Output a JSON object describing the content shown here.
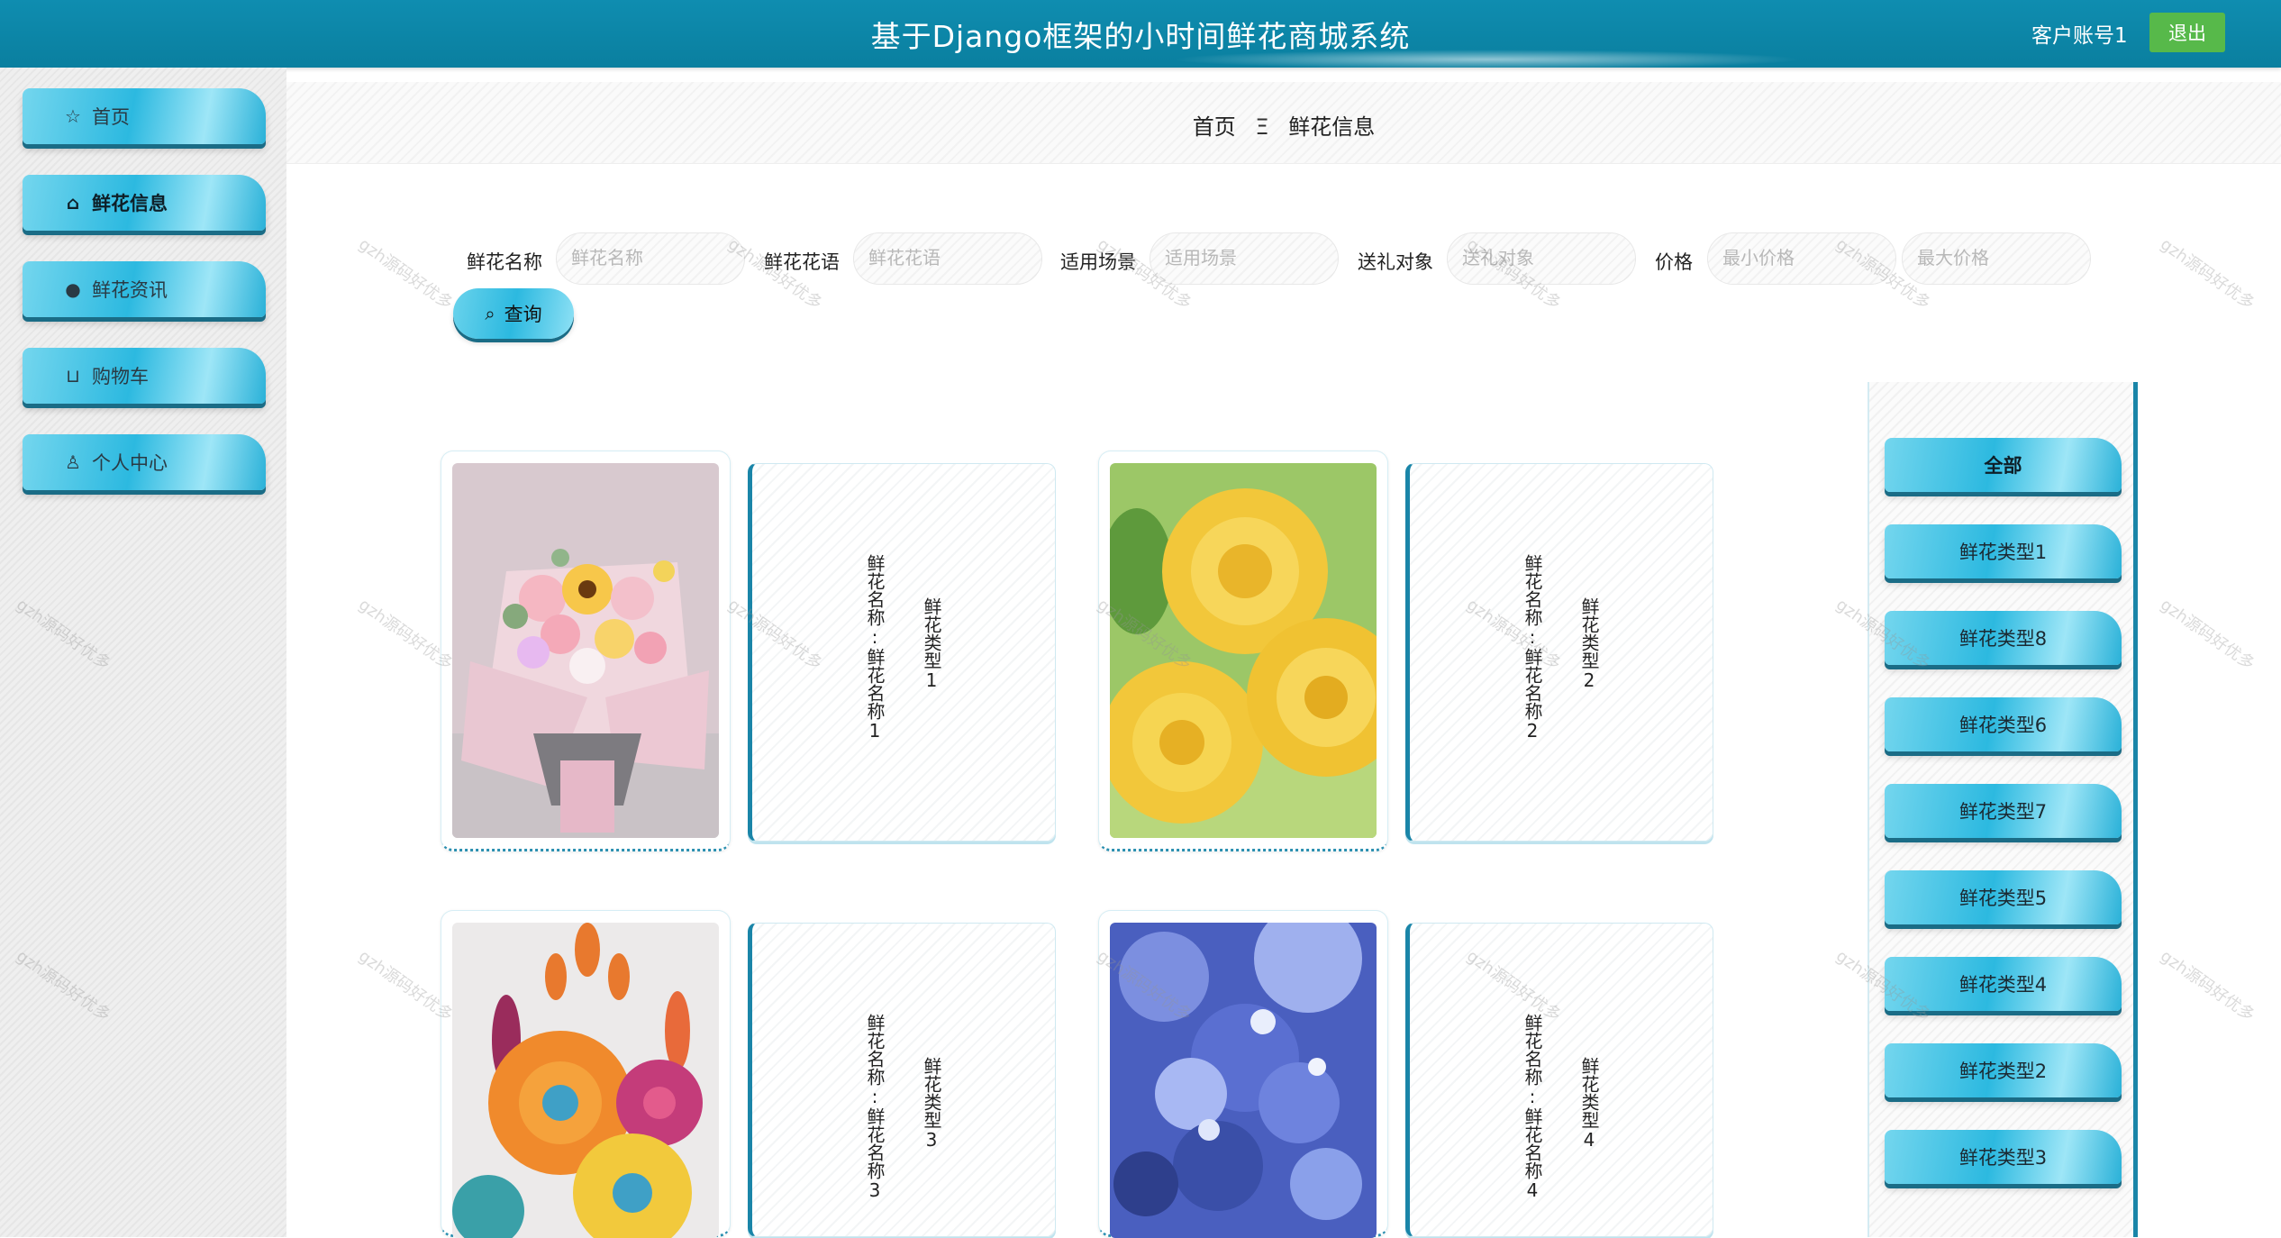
{
  "header": {
    "title": "基于Django框架的小时间鲜花商城系统",
    "user": "客户账号1",
    "logout_label": "退出"
  },
  "sidebar": {
    "items": [
      {
        "label": "首页",
        "icon": "star-icon"
      },
      {
        "label": "鲜花信息",
        "icon": "bag-icon"
      },
      {
        "label": "鲜花资讯",
        "icon": "info-icon"
      },
      {
        "label": "购物车",
        "icon": "cart-icon"
      },
      {
        "label": "个人中心",
        "icon": "user-icon"
      }
    ],
    "active": "鲜花信息"
  },
  "breadcrumb": {
    "home": "首页",
    "separator": "Ξ",
    "current": "鲜花信息"
  },
  "search": {
    "fields": [
      {
        "label": "鲜花名称",
        "placeholder": "鲜花名称"
      },
      {
        "label": "鲜花花语",
        "placeholder": "鲜花花语"
      },
      {
        "label": "适用场景",
        "placeholder": "适用场景"
      },
      {
        "label": "送礼对象",
        "placeholder": "送礼对象"
      },
      {
        "label": "价格",
        "placeholder_min": "最小价格",
        "placeholder_max": "最大价格"
      }
    ],
    "query_label": "查询"
  },
  "products": [
    {
      "name_text": "鲜花名称:鲜花名称1",
      "type_text": "鲜花类型1",
      "image": "bouquet-image"
    },
    {
      "name_text": "鲜花名称:鲜花名称2",
      "type_text": "鲜花类型2",
      "image": "yellow-rose-image"
    },
    {
      "name_text": "鲜花名称:鲜花名称3",
      "type_text": "鲜花类型3",
      "image": "paper-flower-image"
    },
    {
      "name_text": "鲜花名称:鲜花名称4",
      "type_text": "鲜花类型4",
      "image": "blue-flower-image"
    }
  ],
  "categories": [
    "全部",
    "鲜花类型1",
    "鲜花类型8",
    "鲜花类型6",
    "鲜花类型7",
    "鲜花类型5",
    "鲜花类型4",
    "鲜花类型2",
    "鲜花类型3"
  ],
  "watermark": "gzh源码好优多",
  "colors": {
    "header": "#0f8db0",
    "accent": "#2cb9e0",
    "dark_accent": "#1a85a8",
    "logout": "#57b94a"
  }
}
